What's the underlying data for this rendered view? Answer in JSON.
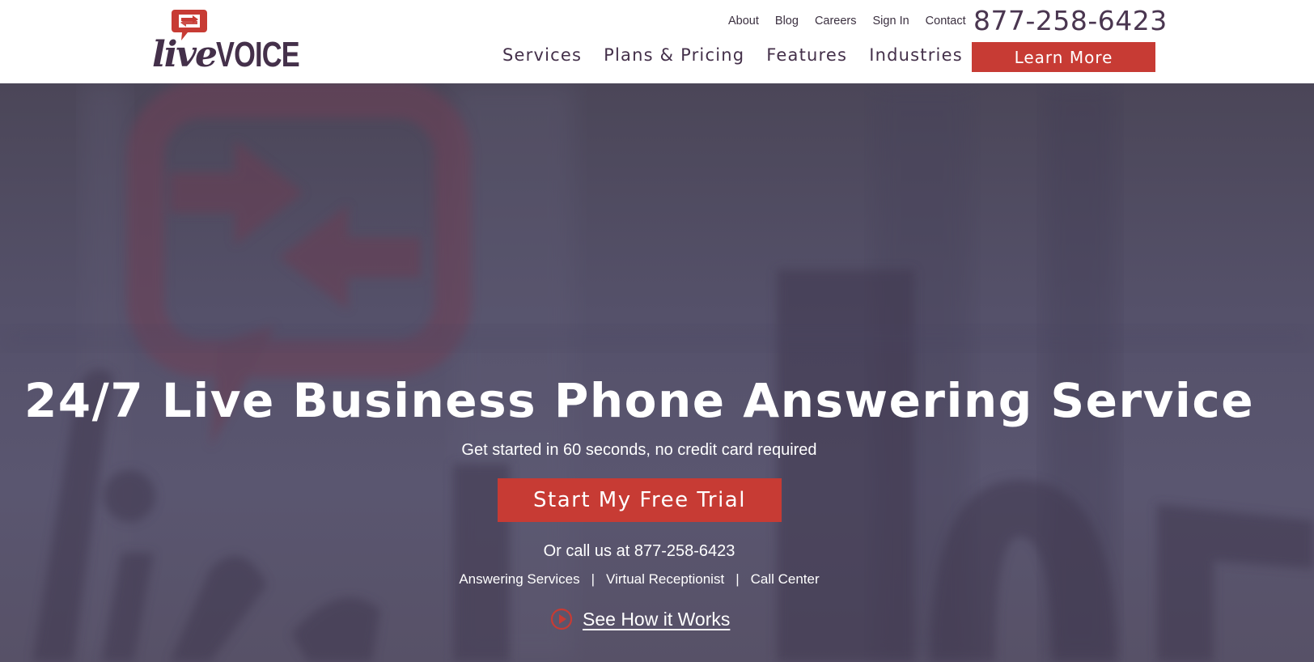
{
  "brand": {
    "logo_text_live": "live",
    "logo_text_voice": "VOICE",
    "accent_color": "#c73b34",
    "brand_dark": "#44304a"
  },
  "header": {
    "top_links": [
      "About",
      "Blog",
      "Careers",
      "Sign In",
      "Contact"
    ],
    "phone": "877-258-6423",
    "nav": [
      "Services",
      "Plans & Pricing",
      "Features",
      "Industries"
    ],
    "learn_more": "Learn More"
  },
  "hero": {
    "title": "24/7 Live Business Phone Answering Service",
    "subtitle": "Get started in 60 seconds, no credit card required",
    "cta": "Start My Free Trial",
    "call_line": "Or call us at 877-258-6423",
    "service_links": [
      "Answering Services",
      "Virtual Receptionist",
      "Call Center"
    ],
    "separator": "|",
    "how_it_works": "See How it Works",
    "how_icon": "play-circle-icon"
  }
}
